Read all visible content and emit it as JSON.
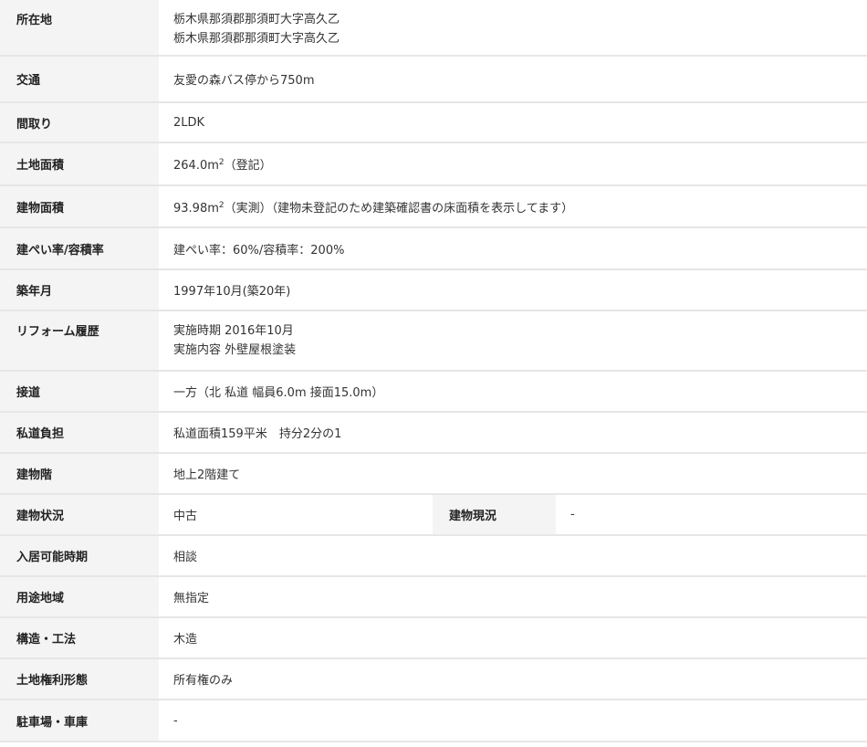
{
  "rows": [
    {
      "label": "所在地",
      "lines": [
        "栃木県那須郡那須町大字高久乙",
        "栃木県那須郡那須町大字高久乙"
      ]
    },
    {
      "label": "交通",
      "value": "友愛の森バス停から750m"
    },
    {
      "label": "間取り",
      "value": "2LDK"
    },
    {
      "label": "土地面積",
      "value_pre": "264.0m",
      "value_sup": "2",
      "value_post": "（登記）"
    },
    {
      "label": "建物面積",
      "value_pre": "93.98m",
      "value_sup": "2",
      "value_post": "（実測）（建物未登記のため建築確認書の床面積を表示してます）"
    },
    {
      "label": "建ぺい率/容積率",
      "value": "建ぺい率：60%/容積率：200%"
    },
    {
      "label": "築年月",
      "value": "1997年10月(築20年)"
    },
    {
      "label": "リフォーム履歴",
      "lines": [
        "実施時期 2016年10月",
        "実施内容 外壁屋根塗装"
      ]
    },
    {
      "label": "接道",
      "value": "一方（北 私道 幅員6.0m 接面15.0m）"
    },
    {
      "label": "私道負担",
      "value": "私道面積159平米　持分2分の1"
    },
    {
      "label": "建物階",
      "value": "地上2階建て"
    },
    {
      "label": "建物状況",
      "value": "中古",
      "label2": "建物現況",
      "value2": "-"
    },
    {
      "label": "入居可能時期",
      "value": "相談"
    },
    {
      "label": "用途地域",
      "value": "無指定"
    },
    {
      "label": "構造・工法",
      "value": "木造"
    },
    {
      "label": "土地権利形態",
      "value": "所有権のみ"
    },
    {
      "label": "駐車場・車庫",
      "value": "-"
    }
  ]
}
